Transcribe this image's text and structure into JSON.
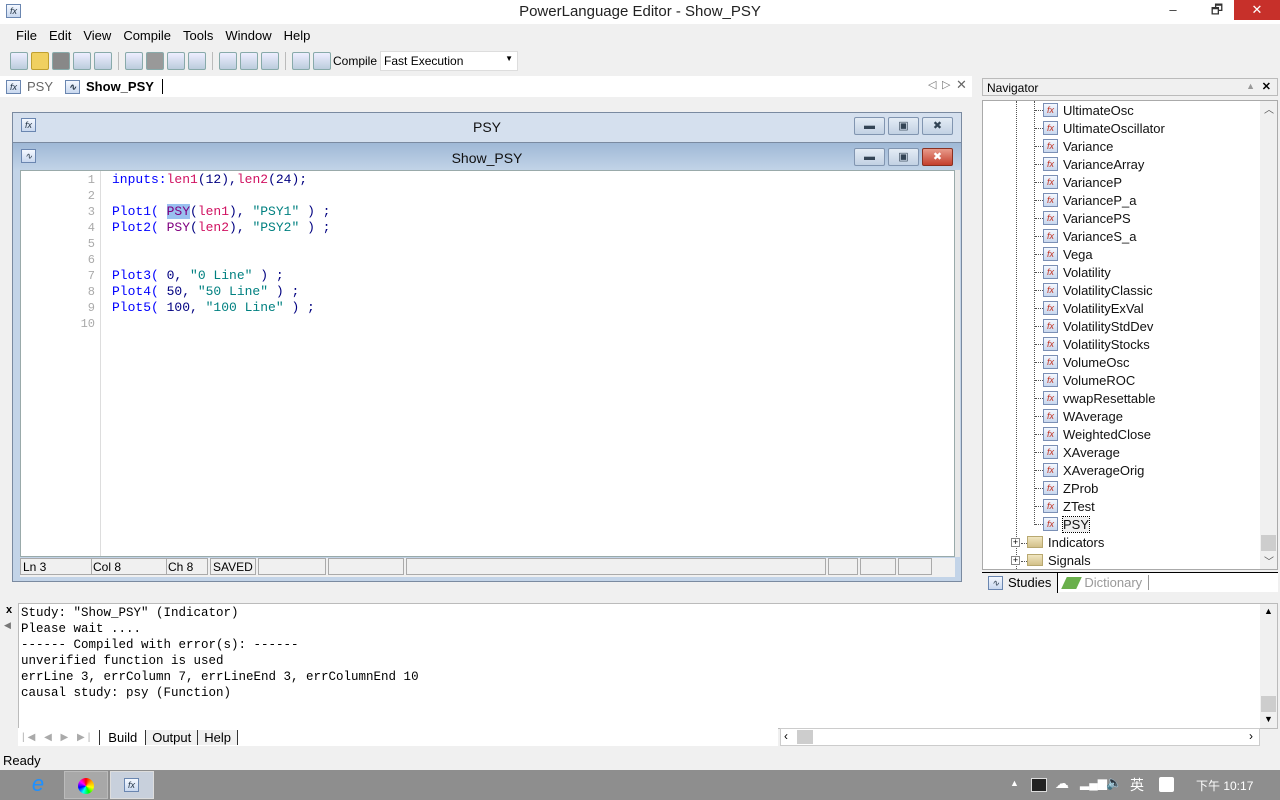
{
  "window": {
    "title": "PowerLanguage Editor - Show_PSY",
    "controls": {
      "minimize": "–",
      "restore": "🗗",
      "close": "✕"
    }
  },
  "menu": [
    "File",
    "Edit",
    "View",
    "Compile",
    "Tools",
    "Window",
    "Help"
  ],
  "toolbar": {
    "compile_label": "Compile",
    "execution_mode": "Fast Execution"
  },
  "doc_tabs": [
    {
      "label": "PSY",
      "icon": "function-icon"
    },
    {
      "label": "Show_PSY",
      "icon": "indicator-icon",
      "active": true
    }
  ],
  "mdi": {
    "psy_window": {
      "title": "PSY"
    },
    "show_window": {
      "title": "Show_PSY"
    }
  },
  "editor": {
    "lines": [
      [
        {
          "t": "inputs:",
          "c": "k"
        },
        {
          "t": "len1",
          "c": "v"
        },
        {
          "t": "(12),",
          "c": "n"
        },
        {
          "t": "len2",
          "c": "v"
        },
        {
          "t": "(24);",
          "c": "n"
        }
      ],
      [],
      [
        {
          "t": "Plot1( ",
          "c": "k"
        },
        {
          "t": "PSY",
          "c": "f sel"
        },
        {
          "t": "(",
          "c": "p"
        },
        {
          "t": "len1",
          "c": "v"
        },
        {
          "t": "), ",
          "c": "p"
        },
        {
          "t": "\"PSY1\"",
          "c": "s"
        },
        {
          "t": " ) ;",
          "c": "p"
        }
      ],
      [
        {
          "t": "Plot2( ",
          "c": "k"
        },
        {
          "t": "PSY",
          "c": "f"
        },
        {
          "t": "(",
          "c": "p"
        },
        {
          "t": "len2",
          "c": "v"
        },
        {
          "t": "), ",
          "c": "p"
        },
        {
          "t": "\"PSY2\"",
          "c": "s"
        },
        {
          "t": " ) ;",
          "c": "p"
        }
      ],
      [],
      [],
      [
        {
          "t": "Plot3( ",
          "c": "k"
        },
        {
          "t": "0, ",
          "c": "n"
        },
        {
          "t": "\"0 Line\"",
          "c": "s"
        },
        {
          "t": " ) ;",
          "c": "p"
        }
      ],
      [
        {
          "t": "Plot4( ",
          "c": "k"
        },
        {
          "t": "50, ",
          "c": "n"
        },
        {
          "t": "\"50 Line\"",
          "c": "s"
        },
        {
          "t": " ) ;",
          "c": "p"
        }
      ],
      [
        {
          "t": "Plot5( ",
          "c": "k"
        },
        {
          "t": "100, ",
          "c": "n"
        },
        {
          "t": "\"100 Line\"",
          "c": "s"
        },
        {
          "t": " ) ;",
          "c": "p"
        }
      ],
      []
    ],
    "status": {
      "ln": "Ln 3",
      "col": "Col 8",
      "ch": "Ch 8",
      "saved": "SAVED"
    }
  },
  "navigator": {
    "title": "Navigator",
    "items": [
      "UltimateOsc",
      "UltimateOscillator",
      "Variance",
      "VarianceArray",
      "VarianceP",
      "VarianceP_a",
      "VariancePS",
      "VarianceS_a",
      "Vega",
      "Volatility",
      "VolatilityClassic",
      "VolatilityExVal",
      "VolatilityStdDev",
      "VolatilityStocks",
      "VolumeOsc",
      "VolumeROC",
      "vwapResettable",
      "WAverage",
      "WeightedClose",
      "XAverage",
      "XAverageOrig",
      "ZProb",
      "ZTest",
      "PSY"
    ],
    "folders": [
      "Indicators",
      "Signals"
    ],
    "tabs": [
      "Studies",
      "Dictionary"
    ]
  },
  "output": {
    "lines": [
      "Study: \"Show_PSY\" (Indicator)",
      "Please wait ....",
      "------ Compiled with error(s): ------",
      "unverified function is used",
      "errLine 3, errColumn 7, errLineEnd 3, errColumnEnd 10",
      "causal study: psy (Function)"
    ],
    "tabs": [
      "Build",
      "Output",
      "Help"
    ]
  },
  "statusbar": {
    "text": "Ready"
  },
  "taskbar": {
    "tray_lang": "英",
    "clock": "下午 10:17"
  }
}
